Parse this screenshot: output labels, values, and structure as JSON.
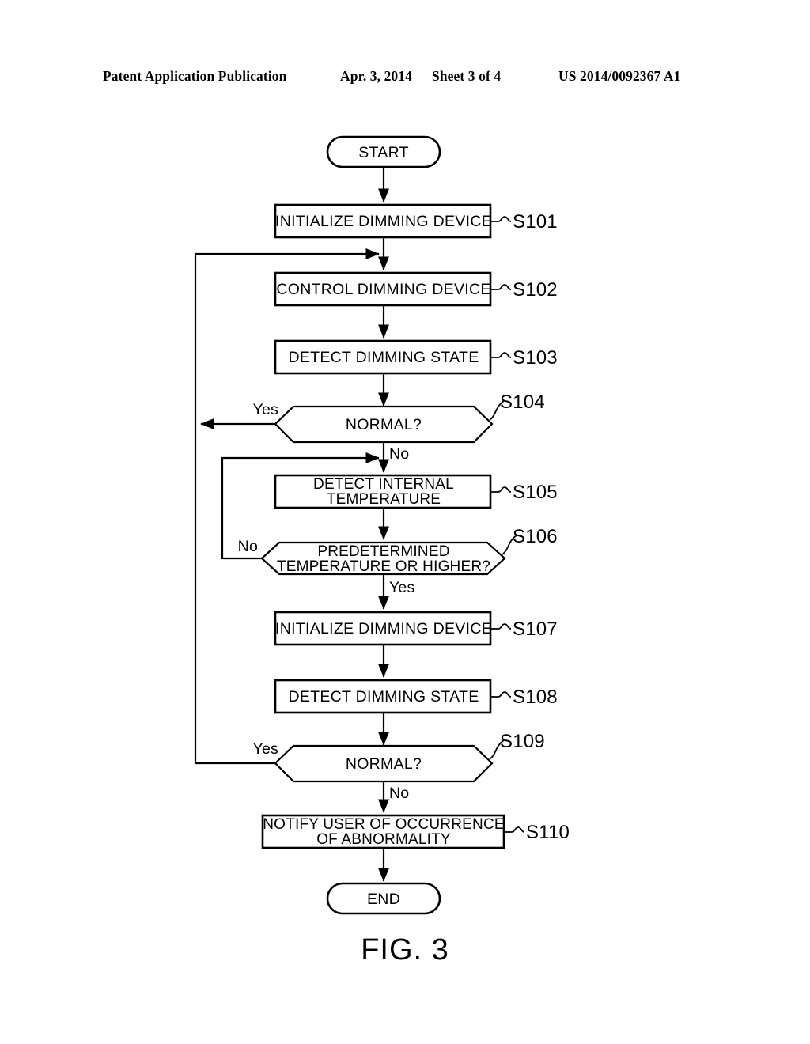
{
  "header": {
    "publication": "Patent Application Publication",
    "date": "Apr. 3, 2014",
    "sheet": "Sheet 3 of 4",
    "patent_number": "US 2014/0092367 A1"
  },
  "figure": {
    "caption": "FIG. 3"
  },
  "flowchart": {
    "start": {
      "label": "START"
    },
    "end": {
      "label": "END"
    },
    "steps": [
      {
        "id": "S101",
        "label": "INITIALIZE DIMMING DEVICE",
        "type": "process",
        "step_label": "S101"
      },
      {
        "id": "S102",
        "label": "CONTROL DIMMING DEVICE",
        "type": "process",
        "step_label": "S102"
      },
      {
        "id": "S103",
        "label": "DETECT DIMMING STATE",
        "type": "process",
        "step_label": "S103"
      },
      {
        "id": "S104",
        "label": "NORMAL?",
        "type": "decision",
        "step_label": "S104"
      },
      {
        "id": "S105",
        "label_line1": "DETECT INTERNAL",
        "label_line2": "TEMPERATURE",
        "type": "process",
        "step_label": "S105"
      },
      {
        "id": "S106",
        "label_line1": "PREDETERMINED",
        "label_line2": "TEMPERATURE OR HIGHER?",
        "type": "decision",
        "step_label": "S106"
      },
      {
        "id": "S107",
        "label": "INITIALIZE DIMMING DEVICE",
        "type": "process",
        "step_label": "S107"
      },
      {
        "id": "S108",
        "label": "DETECT DIMMING STATE",
        "type": "process",
        "step_label": "S108"
      },
      {
        "id": "S109",
        "label": "NORMAL?",
        "type": "decision",
        "step_label": "S109"
      },
      {
        "id": "S110",
        "label_line1": "NOTIFY USER OF OCCURRENCE",
        "label_line2": "OF ABNORMALITY",
        "type": "process",
        "step_label": "S110"
      }
    ],
    "branches": {
      "s104_yes": "Yes",
      "s104_no": "No",
      "s106_no": "No",
      "s106_yes": "Yes",
      "s109_yes": "Yes",
      "s109_no": "No"
    }
  },
  "colors": {
    "ink": "#000000",
    "paper": "#ffffff"
  }
}
